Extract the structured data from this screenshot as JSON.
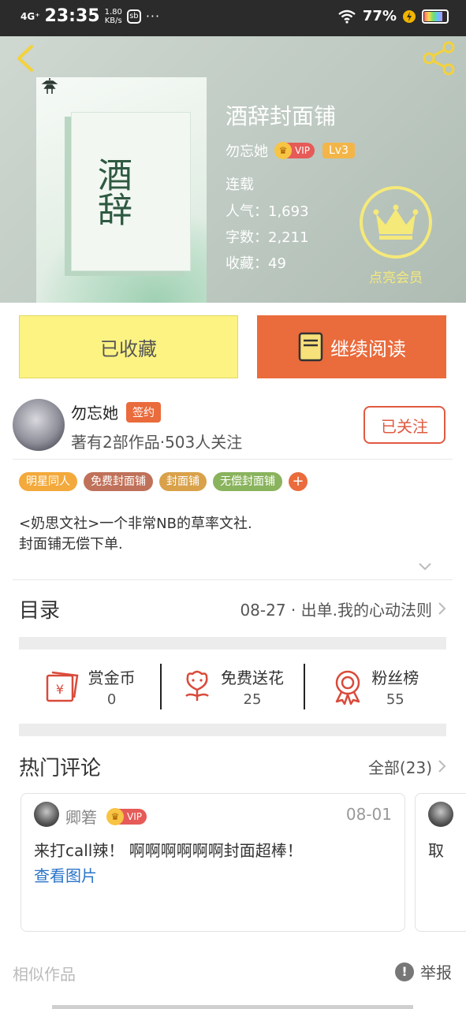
{
  "status_bar": {
    "network": "4G⁺",
    "time": "23:35",
    "speed_value": "1.80",
    "speed_unit": "KB/s",
    "app_icon": "sb",
    "dots": "···",
    "battery_pct": "77%",
    "battery_level": 0.77
  },
  "book": {
    "title": "酒辞封面铺",
    "cover_title": "酒辞",
    "author": "勿忘她",
    "vip_label": "VIP",
    "level": "Lv3",
    "status": "连载",
    "popularity": "人气：1,693",
    "word_count": "字数：2,211",
    "favorites": "收藏：49",
    "member_label": "点亮会员"
  },
  "actions": {
    "favorited_label": "已收藏",
    "continue_label": "继续阅读"
  },
  "author_card": {
    "name": "勿忘她",
    "signed_label": "签约",
    "meta": "著有2部作品·503人关注",
    "follow_label": "已关注"
  },
  "tags": [
    {
      "label": "明星同人",
      "color": "#f3a93b"
    },
    {
      "label": "免费封面铺",
      "color": "#c07159"
    },
    {
      "label": "封面铺",
      "color": "#d9a14a"
    },
    {
      "label": "无偿封面铺",
      "color": "#8ab35d"
    }
  ],
  "tag_add": "+",
  "description": {
    "line1": "<奶思文社>一个非常NB的草率文社.",
    "line2": "封面铺无偿下单."
  },
  "toc": {
    "title": "目录",
    "latest": "08-27 · 出单.我的心动法则"
  },
  "stats": {
    "reward_label": "赏金币",
    "reward_value": "0",
    "flower_label": "免费送花",
    "flower_value": "25",
    "fans_label": "粉丝榜",
    "fans_value": "55"
  },
  "comments": {
    "title": "热门评论",
    "all_label": "全部(23)",
    "items": [
      {
        "user": "卿箬",
        "vip_label": "VIP",
        "date": "08-01",
        "text": "来打call辣！ 啊啊啊啊啊啊封面超棒！",
        "link": "查看图片"
      }
    ],
    "peek_text": "取"
  },
  "footer": {
    "similar": "相似作品",
    "report": "举报",
    "report_icon": "!"
  },
  "colors": {
    "accent": "#ea6b3c",
    "favorite_bg": "#fcf383",
    "member_gold": "#f5e97a",
    "link_blue": "#2a74c9"
  }
}
